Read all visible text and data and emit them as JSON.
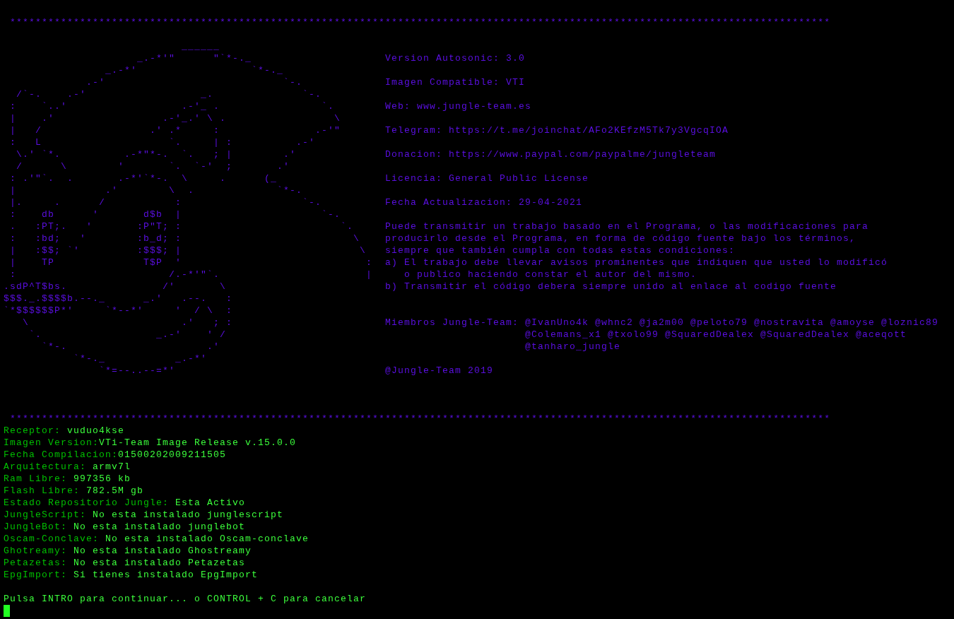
{
  "top_rule": " *********************************************************************************************************************************",
  "ascii_art": [
    "                            ______",
    "                     _.-*'\"      \"`*-._",
    "                _.-*'                  `*-._",
    "             .-'                            `-.",
    "  /`-.    .-'                  _.              `-.",
    " :    `..'                  .-'_ .                `.",
    " |    .'                 .-'_.' \\ .                 \\",
    " |   /                 .' .*     :               .-'\"",
    " :   L                    `.     | :          .-'",
    "  \\.' `*.          .-*\"*-.  `.   ; |        .'",
    "  /      \\        '       `.  `-'  ;       .'",
    " : .'\"`.  .       .-*'`*-.  \\     .      (_",
    " |              .'        \\  .             `*-.",
    " |.     .      /           :                   `-.",
    " :    db      '       d$b  |                      `-.",
    " .   :PT;.   '       :P\"T; :                         `.",
    " :   :bd;   '        :b_d; :                           \\",
    " |   :$$; `'         :$$$; |                            \\",
    " |    TP              T$P  '                             :",
    " :                        /.-*'\"`.                       |",
    ".sdP^T$bs.               /'       \\",
    "$$$._.$$$$b.--._      _.'   .--.   :",
    "`*$$$$$$P*'     `*--*'     '  / \\  :",
    "   \\                        .'   ; :",
    "    `.                  _.-'    ' /",
    "      `*-.                      .'",
    "           `*-._           _.-*'",
    "               `*=--..--=*'"
  ],
  "info_lines": [
    "Version Autosonic: 3.0",
    "Imagen Compatible: VTI",
    "Web: www.jungle-team.es",
    "Telegram: https://t.me/joinchat/AFo2KEfzM5Tk7y3VgcqIOA",
    "Donacion: https://www.paypal.com/paypalme/jungleteam",
    "Licencia: General Public License",
    "Fecha Actualizacion: 29-04-2021"
  ],
  "license_lines": [
    "Puede transmitir un trabajo basado en el Programa, o las modificaciones para",
    "producirlo desde el Programa, en forma de código fuente bajo los términos,",
    "siempre que también cumpla con todas estas condiciones:",
    "a) El trabajo debe llevar avisos prominentes que indiquen que usted lo modificó",
    "   o publico haciendo constar el autor del mismo.",
    "b) Transmitir el código debera siempre unido al enlace al codigo fuente"
  ],
  "members": {
    "label": "Miembros Jungle-Team:",
    "lines": [
      "@IvanUno4k @whnc2 @ja2m00 @peloto79 @nostravita @amoyse @loznic89",
      "@Colemans_x1 @txolo99 @SquaredDealex @SquaredDealex @aceqott",
      "@tanharo_jungle"
    ]
  },
  "copyright": "@Jungle-Team 2019",
  "bottom_rule": " *********************************************************************************************************************************",
  "system_info": [
    {
      "label": "Receptor: ",
      "value": "vuduo4kse"
    },
    {
      "label": "Imagen Version:",
      "value": "VTi-Team Image Release v.15.0.0"
    },
    {
      "label": "Fecha Compilacion:",
      "value": "01500202009211505"
    },
    {
      "label": "Arquitectura: ",
      "value": "armv7l"
    },
    {
      "label": "Ram Libre: ",
      "value": "997356 kb"
    },
    {
      "label": "Flash Libre: ",
      "value": "782.5M gb"
    },
    {
      "label": "Estado Repositorio Jungle: ",
      "value": "Esta Activo"
    },
    {
      "label": "JungleScript: ",
      "value": "No esta instalado junglescript"
    },
    {
      "label": "JungleBot: ",
      "value": "No esta instalado junglebot"
    },
    {
      "label": "Oscam-Conclave: ",
      "value": "No esta instalado Oscam-conclave"
    },
    {
      "label": "Ghotreamy: ",
      "value": "No esta instalado Ghostreamy"
    },
    {
      "label": "Petazetas: ",
      "value": "No esta instalado Petazetas"
    },
    {
      "label": "EpgImport: ",
      "value": "Si tienes instalado EpgImport"
    }
  ],
  "prompt": "Pulsa INTRO para continuar... o CONTROL + C para cancelar"
}
